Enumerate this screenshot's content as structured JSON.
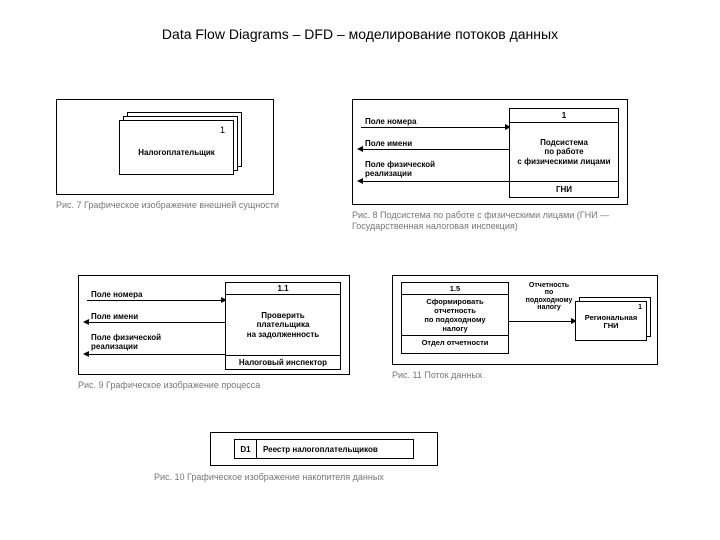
{
  "title": "Data Flow Diagrams – DFD – моделирование потоков данных",
  "fig7": {
    "entity_id": "1",
    "entity_label": "Налогоплательщик",
    "caption": "Рис. 7  Графическое изображение внешней сущности"
  },
  "fig8": {
    "flows": [
      "Поле номера",
      "Поле имени",
      "Поле физической реализации"
    ],
    "proc_id": "1",
    "proc_line1": "Подсистема",
    "proc_line2": "по работе",
    "proc_line3": "с физическими лицами",
    "proc_actor": "ГНИ",
    "caption": "Рис. 8  Подсистема по работе с физическими лицами (ГНИ — Государственная налоговая инспекция)"
  },
  "fig9": {
    "flows": [
      "Поле номера",
      "Поле имени",
      "Поле физической реализации"
    ],
    "proc_id": "1.1",
    "proc_line1": "Проверить",
    "proc_line2": "плательщика",
    "proc_line3": "на задолженность",
    "proc_actor": "Налоговый инспектор",
    "caption": "Рис. 9  Графическое изображение процесса"
  },
  "fig10": {
    "store_id": "D1",
    "store_name": "Реестр налогоплательщиков",
    "caption": "Рис. 10  Графическое изображение накопителя данных"
  },
  "fig11": {
    "proc_id": "1.5",
    "proc_line1": "Сформировать",
    "proc_line2": "отчетность",
    "proc_line3": "по подоходному",
    "proc_line4": "налогу",
    "proc_actor": "Отдел отчетности",
    "flow_line1": "Отчетность",
    "flow_line2": "по подоходному",
    "flow_line3": "налогу",
    "ent_id": "1",
    "ent_line1": "Региональная",
    "ent_line2": "ГНИ",
    "caption": "Рис. 11  Поток данных"
  }
}
